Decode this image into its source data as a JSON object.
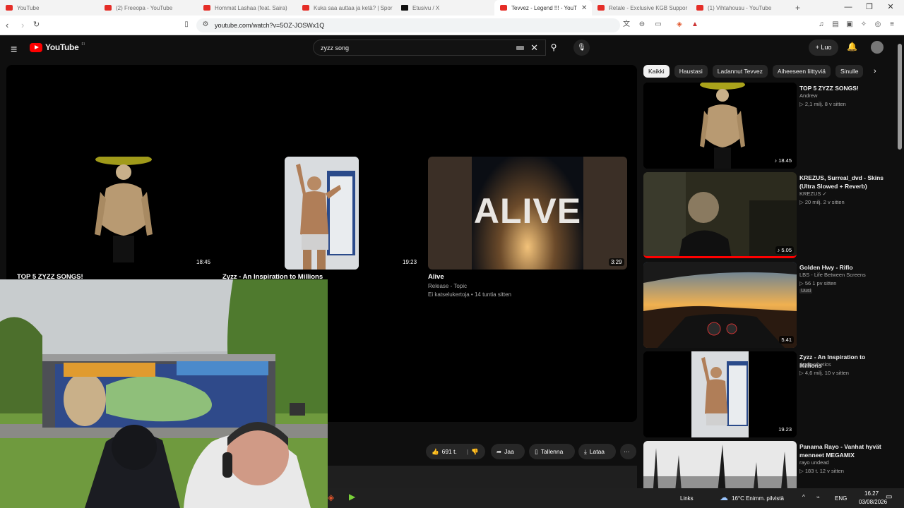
{
  "browser": {
    "tabs": [
      {
        "title": "YouTube",
        "kind": "yt"
      },
      {
        "title": "(2) Freeopa - YouTube",
        "kind": "yt"
      },
      {
        "title": "Hommat Lashaa (feat. Saira)",
        "kind": "yt"
      },
      {
        "title": "Kuka saa auttaa ja ketä? | Spor",
        "kind": "yt"
      },
      {
        "title": "Etusivu / X",
        "kind": "x"
      },
      {
        "title": "Tevvez - Legend !!! - YouT",
        "kind": "yt",
        "active": true
      },
      {
        "title": "Retale - Exclusive KGB Suppor",
        "kind": "yt"
      },
      {
        "title": "(1) Vihtahousu - YouTube",
        "kind": "yt"
      }
    ],
    "new_tab": "+",
    "url": "youtube.com/watch?v=5OZ-JOSWx1Q"
  },
  "youtube": {
    "logo_text": "YouTube",
    "logo_suffix": "FI",
    "search_value": "zyzz song",
    "create_label": "Luo",
    "end_cards": [
      {
        "title": "TOP 5 ZYZZ SONGS!",
        "duration": "18:45"
      },
      {
        "title": "Zyzz - An Inspiration to Millions",
        "duration": "19:23"
      },
      {
        "title": "Alive",
        "duration": "3:29",
        "channel": "Release - Topic",
        "meta": "Ei katselukertoja • 14 tuntia sitten",
        "thumb_text": "ALIVE"
      }
    ],
    "actions": {
      "likes": "691 t.",
      "share": "Jaa",
      "save": "Tallenna",
      "download": "Lataa",
      "more": "···"
    },
    "chips": [
      "Kaikki",
      "Haustasi",
      "Ladannut Tevvez",
      "Aiheeseen liittyviä",
      "Sinulle"
    ],
    "recommendations": [
      {
        "title": "TOP 5 ZYZZ SONGS!",
        "channel": "Andrew",
        "meta": "▷ 2,1 milj.  8 v sitten",
        "duration": "♪ 18.45"
      },
      {
        "title": "KREZUS, Surreal_dvd - Skins (Ultra Slowed + Reverb)",
        "channel": "KREZUS ✓",
        "meta": "▷ 20 milj.  2 v sitten",
        "duration": "♪ 5.05"
      },
      {
        "title": "Golden Hwy - Riflo",
        "channel": "LBS - Life Between Screens",
        "meta": "▷ 56  1 pv sitten",
        "badge": "Uusi",
        "duration": "5.41"
      },
      {
        "title": "Zyzz - An Inspiration to Millions",
        "channel": "Andiesthetics",
        "meta": "▷ 4,6 milj.  10 v sitten",
        "duration": "19.23"
      },
      {
        "title": "Panama Rayo - Vanhat hyvät menneet MEGAMIX",
        "channel": "rayo undead",
        "meta": "▷ 183 t.  12 v sitten",
        "duration": ""
      }
    ]
  },
  "taskbar": {
    "links": "Links",
    "weather": "16°C  Enimm. pilvistä",
    "lang": "ENG",
    "time": "16.27",
    "date": "03/08/2026"
  },
  "colors": {
    "yt_bg": "#0f0f0f",
    "yt_red": "#ff0000",
    "chip_bg": "#272727",
    "tab_strip": "#f3f3f3"
  }
}
